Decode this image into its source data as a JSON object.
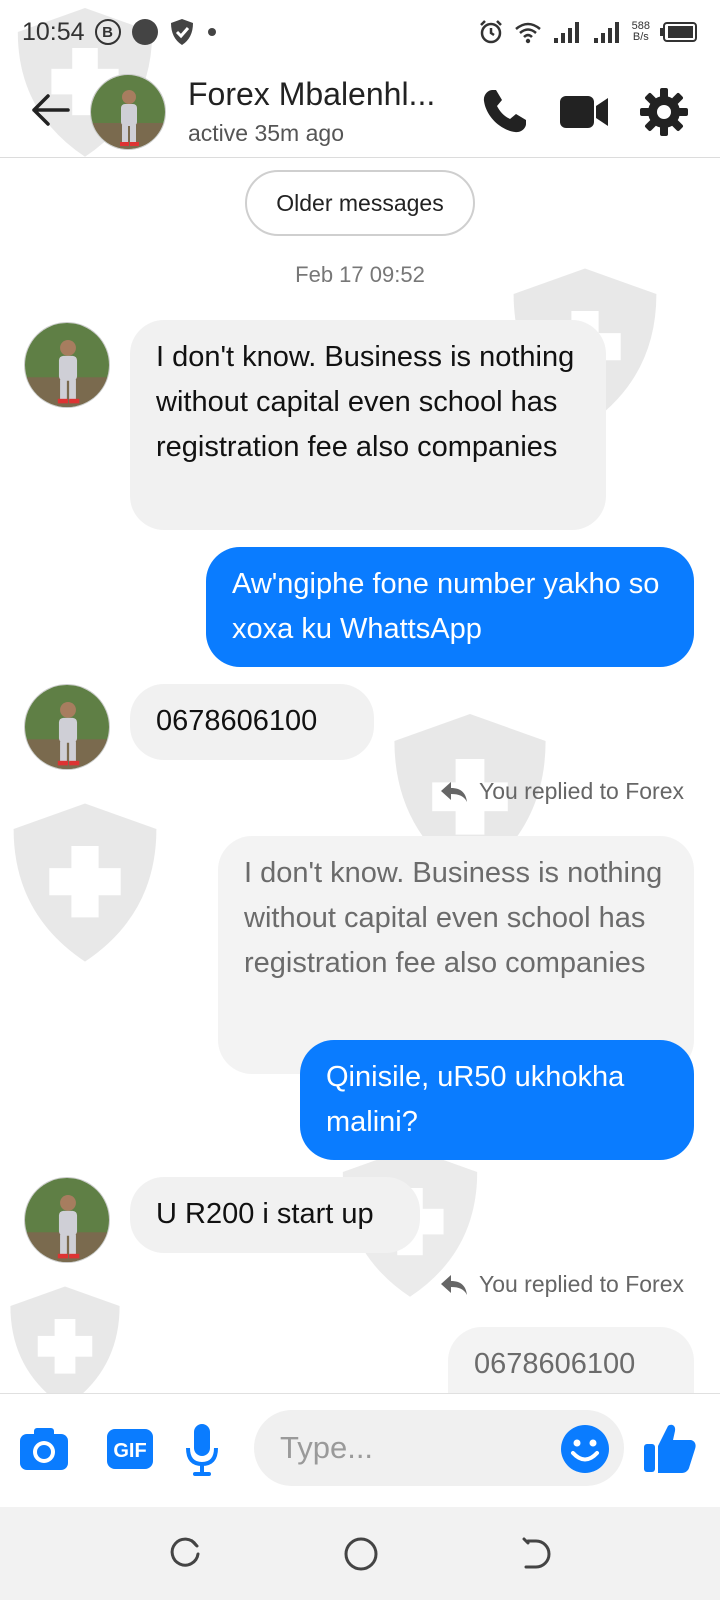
{
  "status_bar": {
    "time": "10:54",
    "badge": "B",
    "speed_value": "588",
    "speed_unit": "B/s"
  },
  "header": {
    "contact_name": "Forex Mbalenhl...",
    "presence": "active 35m ago",
    "icons": [
      "back-arrow",
      "phone",
      "video-camera",
      "gear"
    ]
  },
  "thread": {
    "older_label": "Older messages",
    "timestamp": "Feb 17 09:52",
    "messages": [
      {
        "from": "them",
        "text": "I don't know. Business is nothing without capital even school has registration fee also companies"
      },
      {
        "from": "me",
        "text": "Aw'ngiphe fone number yakho so xoxa ku WhattsApp"
      },
      {
        "from": "them",
        "text": "0678606100"
      },
      {
        "from": "me",
        "reply_note": "You replied to Forex",
        "quoted": "I don't know. Business is nothing without capital even school has registration fee also companies",
        "text": "Qinisile, uR50 ukhokha malini?"
      },
      {
        "from": "them",
        "text": "U R200 i start up"
      },
      {
        "from": "me",
        "reply_note": "You replied to Forex",
        "quoted": "0678606100"
      }
    ]
  },
  "composer": {
    "placeholder": "Type...",
    "gif_label": "GIF",
    "icons": [
      "camera",
      "gif",
      "microphone",
      "emoji",
      "thumbs-up"
    ]
  },
  "colors": {
    "accent": "#0a7cff",
    "incoming_bubble": "#f1f1f1",
    "quoted_bubble": "#f3f3f3"
  }
}
